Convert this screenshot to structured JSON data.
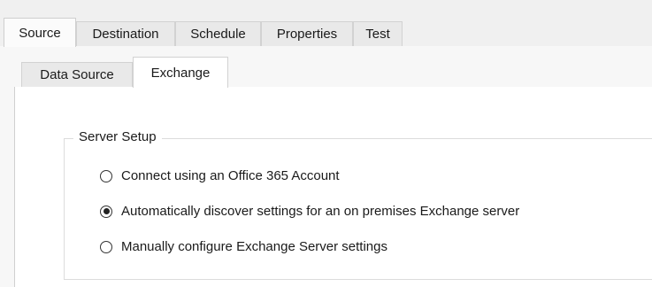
{
  "top_tabs": [
    {
      "label": "Source",
      "active": true
    },
    {
      "label": "Destination",
      "active": false
    },
    {
      "label": "Schedule",
      "active": false
    },
    {
      "label": "Properties",
      "active": false
    },
    {
      "label": "Test",
      "active": false
    }
  ],
  "source_tabs": [
    {
      "label": "Data Source",
      "active": false
    },
    {
      "label": "Exchange",
      "active": true
    }
  ],
  "server_setup": {
    "legend": "Server Setup",
    "options": [
      {
        "label": "Connect using an Office 365 Account",
        "checked": false
      },
      {
        "label": "Automatically discover settings for an on premises Exchange server",
        "checked": true
      },
      {
        "label": "Manually configure Exchange Server settings",
        "checked": false
      }
    ]
  }
}
